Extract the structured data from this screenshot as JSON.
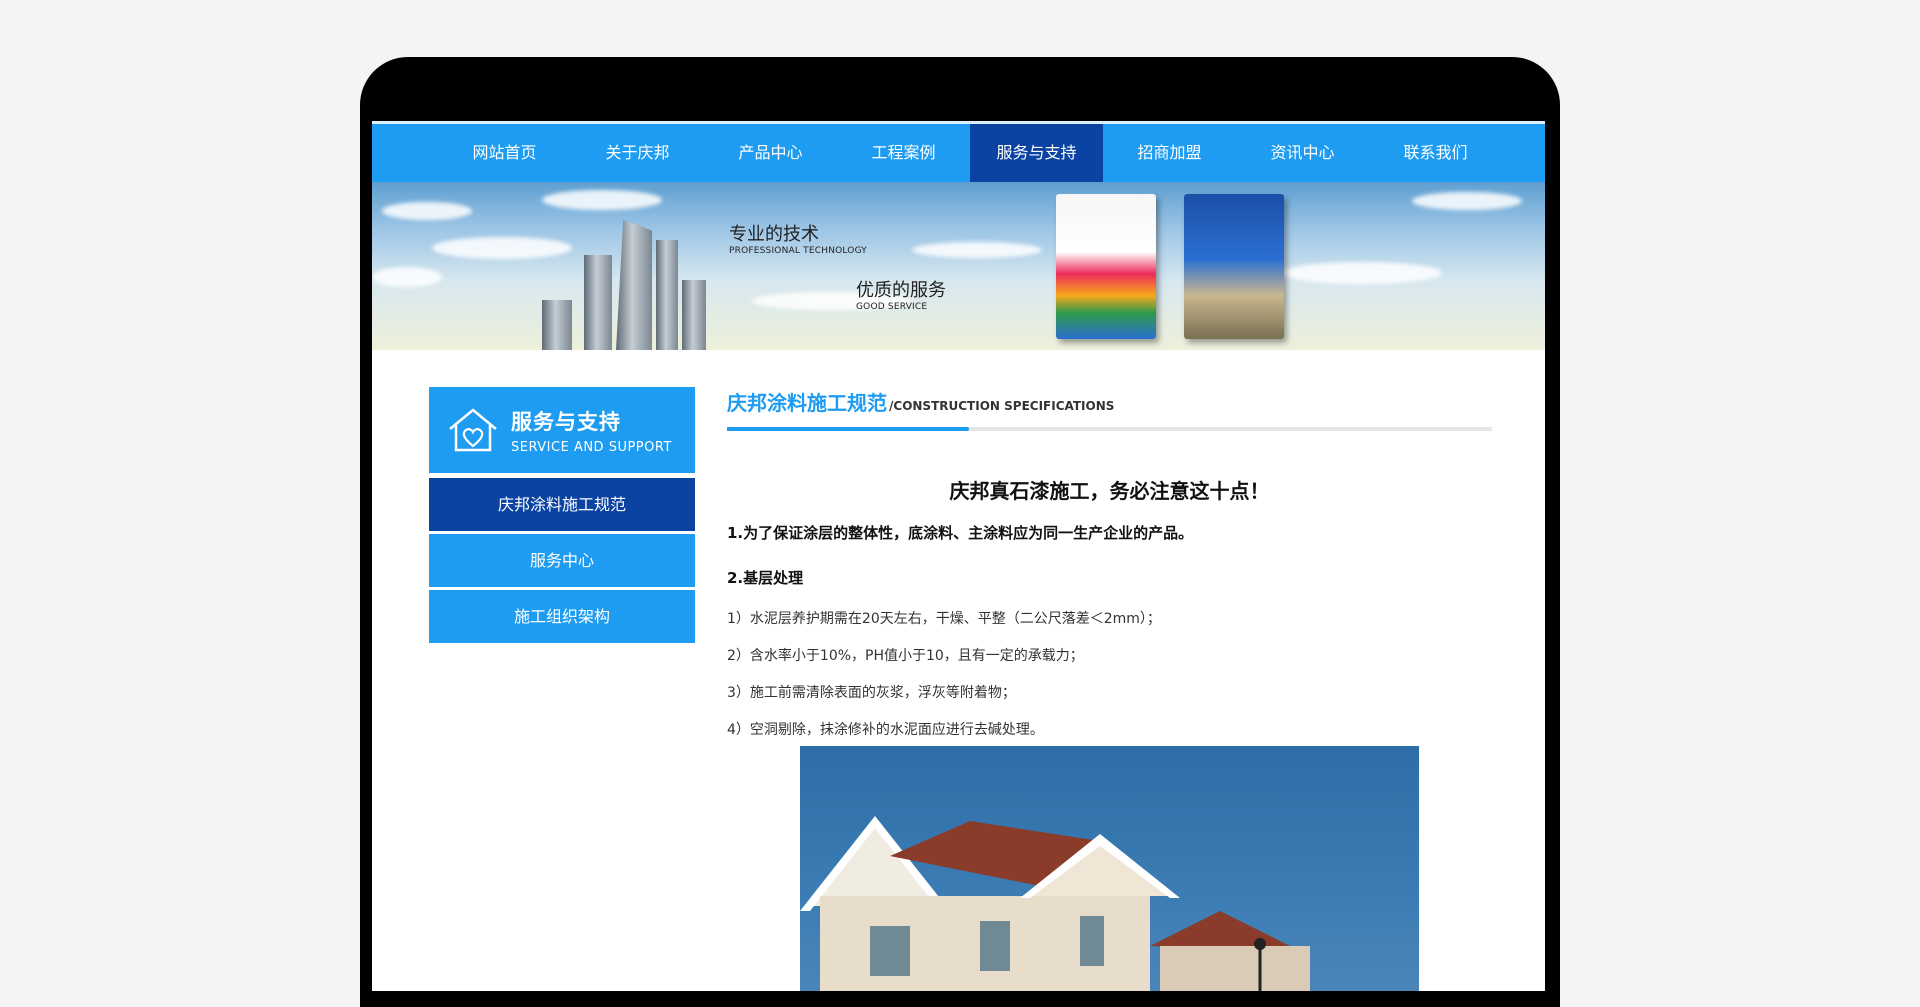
{
  "nav": {
    "items": [
      "网站首页",
      "关于庆邦",
      "产品中心",
      "工程案例",
      "服务与支持",
      "招商加盟",
      "资讯中心",
      "联系我们"
    ],
    "active_index": 4
  },
  "banner": {
    "slogan1": "专业的技术",
    "slogan1_en": "PROFESSIONAL TECHNOLOGY",
    "slogan2": "优质的服务",
    "slogan2_en": "GOOD SERVICE"
  },
  "sidebar": {
    "title": "服务与支持",
    "subtitle": "SERVICE AND SUPPORT",
    "items": [
      "庆邦涂料施工规范",
      "服务中心",
      "施工组织架构"
    ],
    "active_index": 0
  },
  "main": {
    "section_title": "庆邦涂料施工规范",
    "section_title_en": "/CONSTRUCTION SPECIFICATIONS",
    "article_title": "庆邦真石漆施工，务必注意这十点！",
    "p1": "1.为了保证涂层的整体性，底涂料、主涂料应为同一生产企业的产品。",
    "p2": "2.基层处理",
    "lines": [
      "1）水泥层养护期需在20天左右，干燥、平整（二公尺落差＜2mm）；",
      "2）含水率小于10%，PH值小于10，且有一定的承载力；",
      "3）施工前需清除表面的灰浆，浮灰等附着物；",
      "4）空洞剔除，抹涂修补的水泥面应进行去碱处理。"
    ]
  },
  "colors": {
    "primary": "#1e9cf2",
    "active": "#0b43a3"
  }
}
